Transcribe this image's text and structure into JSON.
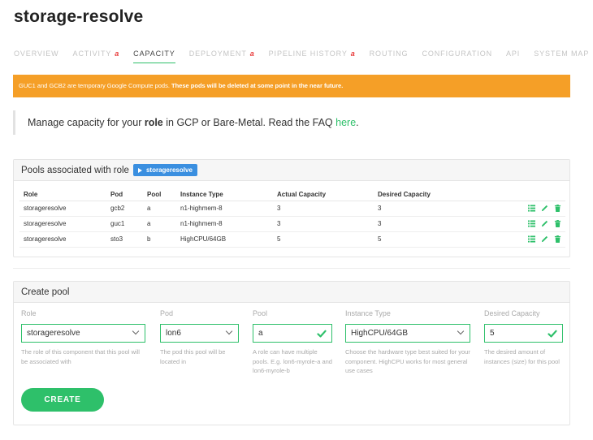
{
  "app": {
    "title": "storage-resolve"
  },
  "tabs": [
    {
      "label": "OVERVIEW",
      "alert": ""
    },
    {
      "label": "ACTIVITY",
      "alert": "a"
    },
    {
      "label": "CAPACITY",
      "alert": ""
    },
    {
      "label": "DEPLOYMENT",
      "alert": "a"
    },
    {
      "label": "PIPELINE HISTORY",
      "alert": "a"
    },
    {
      "label": "ROUTING",
      "alert": ""
    },
    {
      "label": "CONFIGURATION",
      "alert": ""
    },
    {
      "label": "API",
      "alert": ""
    },
    {
      "label": "SYSTEM MAP",
      "alert": ""
    }
  ],
  "active_tab": "CAPACITY",
  "banner": {
    "text": "GUC1 and GCB2 are temporary Google Compute pods. ",
    "bold": "These pods will be deleted at some point in the near future."
  },
  "intro": {
    "prefix": "Manage capacity for your ",
    "bold": "role",
    "middle": " in GCP or Bare-Metal. Read the FAQ ",
    "link": "here",
    "suffix": "."
  },
  "pools_panel": {
    "title": "Pools associated with role",
    "role_badge": "storageresolve",
    "columns": [
      "Role",
      "Pod",
      "Pool",
      "Instance Type",
      "Actual Capacity",
      "Desired Capacity"
    ],
    "rows": [
      {
        "role": "storageresolve",
        "pod": "gcb2",
        "pool": "a",
        "instance_type": "n1-highmem-8",
        "actual": "3",
        "desired": "3"
      },
      {
        "role": "storageresolve",
        "pod": "guc1",
        "pool": "a",
        "instance_type": "n1-highmem-8",
        "actual": "3",
        "desired": "3"
      },
      {
        "role": "storageresolve",
        "pod": "sto3",
        "pool": "b",
        "instance_type": "HighCPU/64GB",
        "actual": "5",
        "desired": "5"
      }
    ],
    "row_action_icons": [
      "list-icon",
      "pencil-icon",
      "trash-icon"
    ]
  },
  "create_panel": {
    "title": "Create pool",
    "fields": {
      "role": {
        "label": "Role",
        "value": "storageresolve",
        "help": "The role of this component that this pool will be associated with"
      },
      "pod": {
        "label": "Pod",
        "value": "lon6",
        "help": "The pod this pool will be located in"
      },
      "pool": {
        "label": "Pool",
        "value": "a",
        "help": "A role can have multiple pools. E.g. lon6-myrole-a and lon6-myrole-b"
      },
      "instance_type": {
        "label": "Instance Type",
        "value": "HighCPU/64GB",
        "help": "Choose the hardware type best suited for your component. HighCPU works for most general use cases"
      },
      "desired_capacity": {
        "label": "Desired Capacity",
        "value": "5",
        "help": "The desired amount of instances (size) for this pool"
      }
    },
    "create_label": "CREATE"
  },
  "colors": {
    "accent": "#2ec06a",
    "banner": "#f59f27",
    "badge": "#3a8fe0",
    "alert": "#e83a3a"
  }
}
